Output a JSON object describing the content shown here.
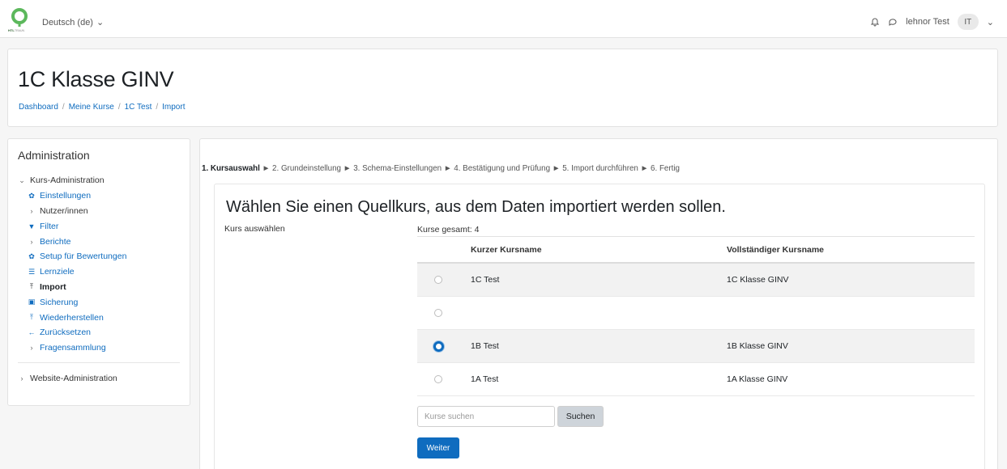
{
  "navbar": {
    "language": "Deutsch (de)",
    "user_name": "lehnor Test",
    "user_initials": "IT"
  },
  "header": {
    "title": "1C Klasse GINV",
    "breadcrumb": [
      "Dashboard",
      "Meine Kurse",
      "1C Test",
      "Import"
    ],
    "separator": "/"
  },
  "sidebar": {
    "title": "Administration",
    "section": "Kurs-Administration",
    "items": [
      {
        "label": "Einstellungen",
        "icon": "gear-icon"
      },
      {
        "label": "Nutzer/innen",
        "icon": "chevron-right-icon"
      },
      {
        "label": "Filter",
        "icon": "filter-icon"
      },
      {
        "label": "Berichte",
        "icon": "chevron-right-icon"
      },
      {
        "label": "Setup für Bewertungen",
        "icon": "gear-icon"
      },
      {
        "label": "Lernziele",
        "icon": "list-icon"
      },
      {
        "label": "Import",
        "icon": "import-icon"
      },
      {
        "label": "Sicherung",
        "icon": "save-icon"
      },
      {
        "label": "Wiederherstellen",
        "icon": "restore-icon"
      },
      {
        "label": "Zurücksetzen",
        "icon": "arrow-left-icon"
      },
      {
        "label": "Fragensammlung",
        "icon": "chevron-right-icon"
      }
    ],
    "site_admin": "Website-Administration"
  },
  "steps": {
    "current": "1. Kursauswahl",
    "rest": [
      "2. Grundeinstellung",
      "3. Schema-Einstellungen",
      "4. Bestätigung und Prüfung",
      "5. Import durchführen",
      "6. Fertig"
    ],
    "arrow": "►"
  },
  "main": {
    "heading": "Wählen Sie einen Quellkurs, aus dem Daten importiert werden sollen.",
    "select_label": "Kurs auswählen",
    "count_text": "Kurse gesamt: 4",
    "columns": [
      "Kurzer Kursname",
      "Vollständiger Kursname"
    ],
    "rows": [
      {
        "short": "1C Test",
        "full": "1C Klasse GINV",
        "selected": false
      },
      {
        "short": "",
        "full": "",
        "selected": false
      },
      {
        "short": "1B Test",
        "full": "1B Klasse GINV",
        "selected": true
      },
      {
        "short": "1A Test",
        "full": "1A Klasse GINV",
        "selected": false
      }
    ],
    "search_placeholder": "Kurse suchen",
    "search_button": "Suchen",
    "next_button": "Weiter"
  },
  "colors": {
    "primary": "#0f6cbf",
    "logo_green": "#5cb85c",
    "background": "#f6f6f6"
  }
}
